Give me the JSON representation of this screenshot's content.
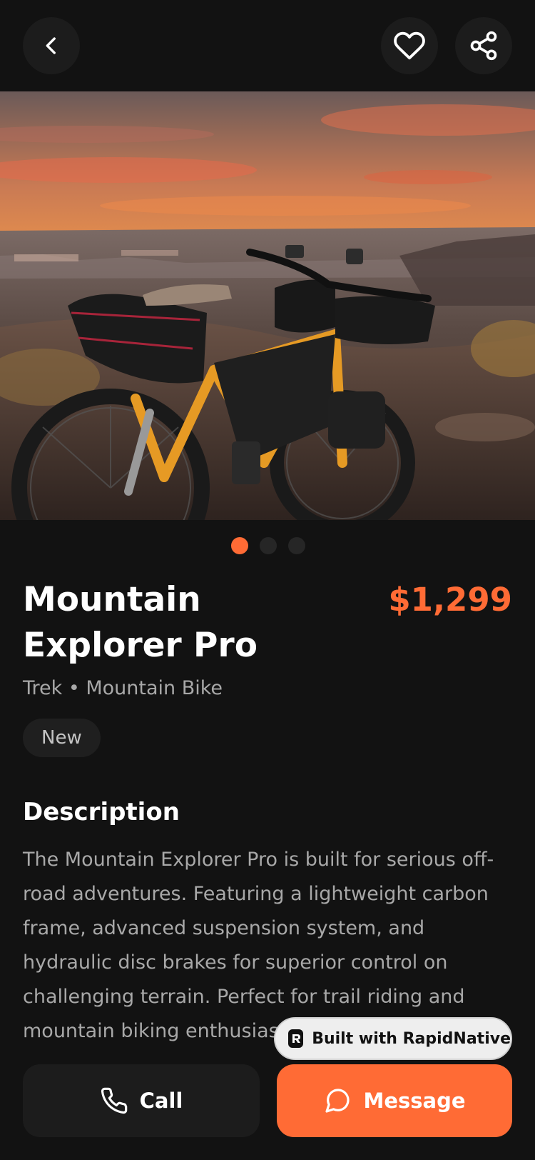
{
  "header": {
    "back_icon": "chevron-left-icon",
    "favorite_icon": "heart-icon",
    "share_icon": "share-icon"
  },
  "gallery": {
    "image_count": 3,
    "active_index": 0
  },
  "product": {
    "title": "Mountain Explorer Pro",
    "price": "$1,299",
    "subtitle": "Trek • Mountain Bike",
    "condition": "New"
  },
  "description": {
    "heading": "Description",
    "text": "The Mountain Explorer Pro is built for serious off-road adventures. Featuring a lightweight carbon frame, advanced suspension system, and hydraulic disc brakes for superior control on challenging terrain. Perfect for trail riding and mountain biking enthusiasts."
  },
  "badge": {
    "label": "Built with RapidNative"
  },
  "actions": {
    "call_label": "Call",
    "message_label": "Message"
  },
  "colors": {
    "accent": "#ff6b35",
    "background": "#121212",
    "surface": "#1c1c1c"
  }
}
